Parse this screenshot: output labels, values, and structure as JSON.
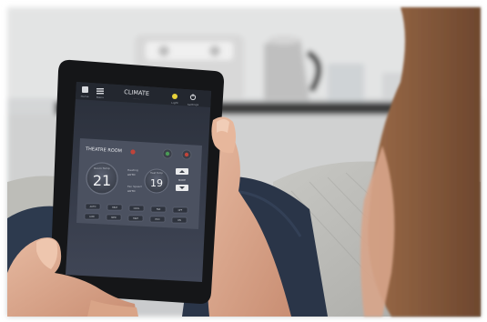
{
  "app": {
    "title": "CLIMATE",
    "subtitle": "..........",
    "nav_labels": [
      "Home",
      "Menu",
      "",
      "Light",
      "Settings"
    ]
  },
  "room": {
    "name": "THEATRE ROOM"
  },
  "climate": {
    "room_temp_label": "Room Temp",
    "room_temp": "21",
    "set_temp_label": "Heat Temp",
    "set_temp": "19",
    "mode_label_1": "Heating",
    "mode_value_1": "AUTO",
    "mode_label_2": "Fan Speed",
    "mode_value_2": "AUTO",
    "stepper_mid": "MODE"
  },
  "buttons": {
    "row1": [
      "AUTO",
      "HEAT",
      "COOL",
      "FAN",
      "OFF"
    ],
    "row2": [
      "LOW",
      "MED",
      "HIGH",
      "ECO",
      "ON"
    ]
  },
  "colors": {
    "screen_bg": "#3a4150",
    "panel_bg": "#4b5160",
    "header_bg": "#2a2f3a",
    "accent_yellow": "#e8d23a",
    "status_red": "#c0443a",
    "status_green": "#4a9a55"
  },
  "icons": {
    "home": "home-icon",
    "menu": "menu-icon",
    "light": "bulb-icon",
    "settings": "power-icon"
  }
}
